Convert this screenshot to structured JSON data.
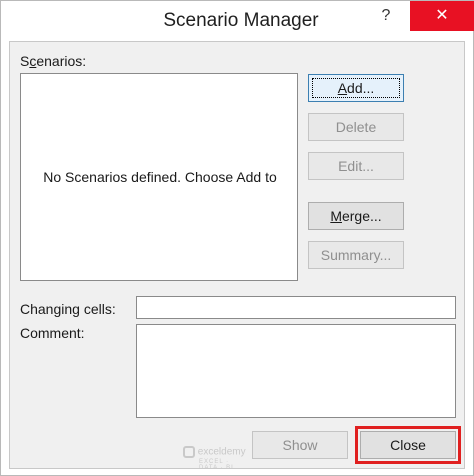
{
  "window": {
    "title": "Scenario Manager",
    "help_glyph": "?",
    "close_glyph": "✕"
  },
  "scenarios": {
    "label_prefix": "S",
    "label_underlined": "c",
    "label_rest": "enarios:",
    "empty_message": "No Scenarios defined. Choose Add to"
  },
  "buttons": {
    "add_u": "A",
    "add_rest": "dd...",
    "delete": "Delete",
    "edit": "Edit...",
    "merge_u": "M",
    "merge_rest": "erge...",
    "summary": "Summary...",
    "show": "Show",
    "close": "Close"
  },
  "fields": {
    "changing_cells_label": "Changing cells:",
    "changing_cells_value": "",
    "comment_label": "Comment:",
    "comment_value": ""
  },
  "watermark": {
    "logo_text": "exceldemy",
    "tagline": "EXCEL · DATA · BI"
  },
  "colors": {
    "highlight": "#e02020",
    "close_hover": "#e81123"
  }
}
